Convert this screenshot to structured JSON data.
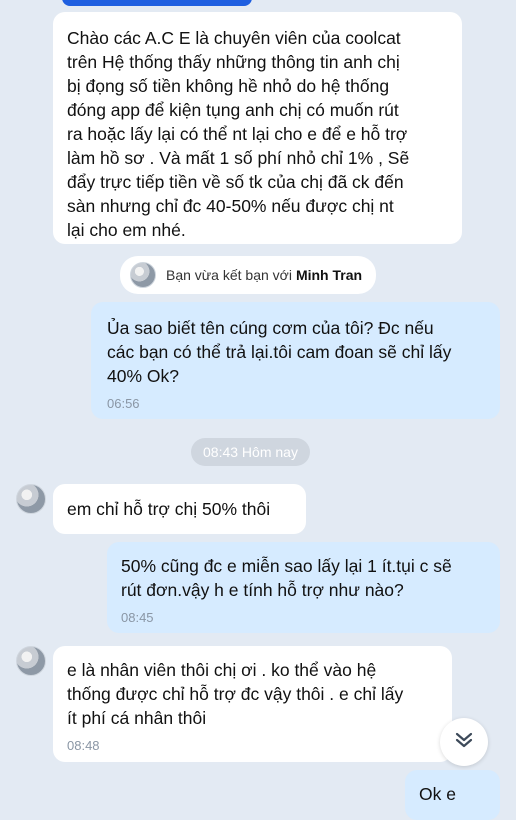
{
  "messages": [
    {
      "text": "Chào các A.C E là chuyên viên của coolcat\ntrên Hệ thống thấy những thông tin anh chị\nbị đọng số tiền không hề nhỏ do hệ thống\nđóng app để kiện tụng anh chị có muốn rút\nra hoặc lấy lại  có thể nt lại cho e để e hỗ trợ\nlàm hồ sơ . Và mất 1 số phí nhỏ chỉ 1% , Sẽ\nđẩy trực tiếp tiền về số tk của chị đã ck đến\nsàn nhưng chỉ đc 40-50% nếu được chị nt\nlại cho em nhé."
    },
    {
      "text": "Ủa sao biết tên cúng cơm của tôi? Đc nếu\ncác bạn có thể trả lại.tôi cam đoan sẽ chỉ lấy\n40% Ok?",
      "time": "06:56"
    },
    {
      "text": "em chỉ hỗ trợ chị 50% thôi"
    },
    {
      "text": "50% cũng đc e miễn sao lấy lại 1 ít.tụi c sẽ\nrút đơn.vậy h e tính hỗ trợ như nào?",
      "time": "08:45"
    },
    {
      "text": "e là nhân viên thôi chị ơi . ko thể vào hệ\nthống được chỉ hỗ trợ đc vậy thôi . e chỉ lấy\nít phí cá nhân thôi",
      "time": "08:48"
    },
    {
      "text": "Ok e"
    }
  ],
  "friend_notice": {
    "prefix": "Bạn vừa kết bạn với",
    "name": "Minh Tran"
  },
  "date_divider": "08:43 Hôm nay",
  "scroll_icon": "chevron-double-down-icon"
}
